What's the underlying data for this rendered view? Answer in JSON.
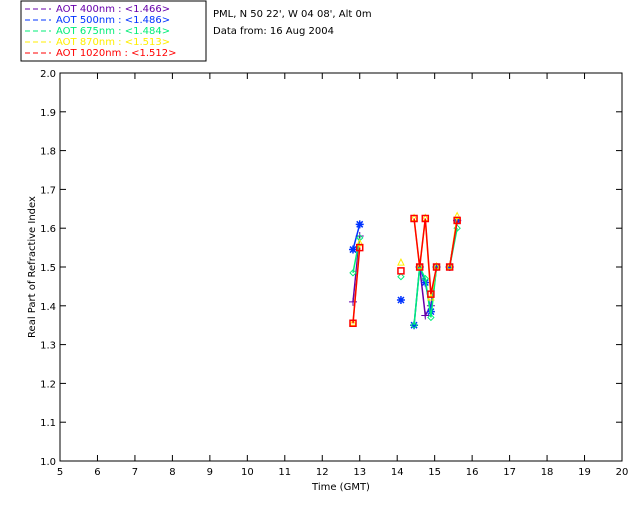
{
  "header": {
    "site": "PML, N 50 22', W 04 08', Alt 0m",
    "date": "Data from: 16 Aug 2004"
  },
  "chart_data": {
    "type": "line",
    "xlabel": "Time (GMT)",
    "ylabel": "Real Part of Refractive Index",
    "xlim": [
      5,
      20
    ],
    "ylim": [
      1.0,
      2.0
    ],
    "xticks": [
      "5",
      "6",
      "7",
      "8",
      "9",
      "10",
      "11",
      "12",
      "13",
      "14",
      "15",
      "16",
      "17",
      "18",
      "19",
      "20"
    ],
    "yticks": [
      "1.0",
      "1.1",
      "1.2",
      "1.3",
      "1.4",
      "1.5",
      "1.6",
      "1.7",
      "1.8",
      "1.9",
      "2.0"
    ],
    "legend_position": "top-left",
    "series": [
      {
        "name": "AOT  400nm : <1.466>",
        "color": "#6600aa",
        "marker": "plus",
        "segments": [
          [
            [
              12.82,
              1.41
            ],
            [
              13.0,
              1.58
            ]
          ],
          [
            [
              14.6,
              1.5
            ],
            [
              14.75,
              1.375
            ],
            [
              14.9,
              1.4
            ],
            [
              15.05,
              1.5
            ]
          ],
          [
            [
              15.4,
              1.5
            ],
            [
              15.6,
              1.62
            ]
          ]
        ]
      },
      {
        "name": "AOT  500nm : <1.486>",
        "color": "#0033ff",
        "marker": "asterisk",
        "segments": [
          [
            [
              12.82,
              1.545
            ],
            [
              13.0,
              1.61
            ]
          ],
          [
            [
              14.1,
              1.415
            ]
          ],
          [
            [
              14.45,
              1.35
            ],
            [
              14.6,
              1.5
            ],
            [
              14.75,
              1.46
            ],
            [
              14.9,
              1.385
            ],
            [
              15.05,
              1.5
            ]
          ],
          [
            [
              15.4,
              1.5
            ],
            [
              15.6,
              1.62
            ]
          ]
        ]
      },
      {
        "name": "AOT  675nm : <1.484>",
        "color": "#00ee77",
        "marker": "diamond",
        "segments": [
          [
            [
              12.82,
              1.485
            ],
            [
              13.0,
              1.575
            ]
          ],
          [
            [
              14.1,
              1.475
            ]
          ],
          [
            [
              14.45,
              1.35
            ],
            [
              14.6,
              1.5
            ],
            [
              14.75,
              1.47
            ],
            [
              14.9,
              1.37
            ],
            [
              15.05,
              1.5
            ]
          ],
          [
            [
              15.4,
              1.5
            ],
            [
              15.6,
              1.6
            ]
          ]
        ]
      },
      {
        "name": "AOT  870nm : <1.513>",
        "color": "#ffee00",
        "marker": "triangle",
        "segments": [
          [
            [
              12.82,
              1.355
            ],
            [
              13.0,
              1.56
            ]
          ],
          [
            [
              14.1,
              1.51
            ]
          ],
          [
            [
              14.45,
              1.625
            ],
            [
              14.6,
              1.5
            ],
            [
              14.75,
              1.625
            ],
            [
              14.9,
              1.42
            ],
            [
              15.05,
              1.5
            ]
          ],
          [
            [
              15.4,
              1.5
            ],
            [
              15.6,
              1.63
            ]
          ]
        ]
      },
      {
        "name": "AOT 1020nm : <1.512>",
        "color": "#ff0000",
        "marker": "square",
        "segments": [
          [
            [
              12.82,
              1.355
            ],
            [
              13.0,
              1.55
            ]
          ],
          [
            [
              14.1,
              1.49
            ]
          ],
          [
            [
              14.45,
              1.625
            ],
            [
              14.6,
              1.5
            ],
            [
              14.75,
              1.625
            ],
            [
              14.9,
              1.43
            ],
            [
              15.05,
              1.5
            ]
          ],
          [
            [
              15.4,
              1.5
            ],
            [
              15.6,
              1.62
            ]
          ]
        ]
      }
    ]
  }
}
